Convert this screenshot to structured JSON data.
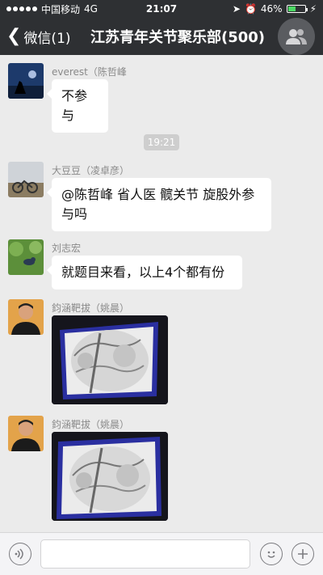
{
  "status_bar": {
    "carrier": "中国移动",
    "network": "4G",
    "time": "21:07",
    "battery": "46%",
    "battery_level": 0.46
  },
  "nav": {
    "back_label": "微信(1)",
    "title": "江苏青年关节聚乐部(500)"
  },
  "messages": [
    {
      "sender": "everest（陈哲峰",
      "text": "不参与"
    },
    {
      "sender": "大豆豆（凌卓彦）",
      "text": "@陈哲峰 省人医 髋关节 旋股外参与吗"
    },
    {
      "sender": "刘志宏",
      "text": "就题目来看，以上4个都有份"
    },
    {
      "sender": "鈞涵靶拔（姚晨）",
      "image": "x-ray-photo"
    },
    {
      "sender": "鈞涵靶拔（姚晨）",
      "image": "x-ray-photo"
    }
  ],
  "timestamp": "19:21",
  "input_bar": {
    "voice_icon": "voice-icon",
    "emoji_icon": "emoji-icon",
    "more_icon": "plus-icon"
  }
}
